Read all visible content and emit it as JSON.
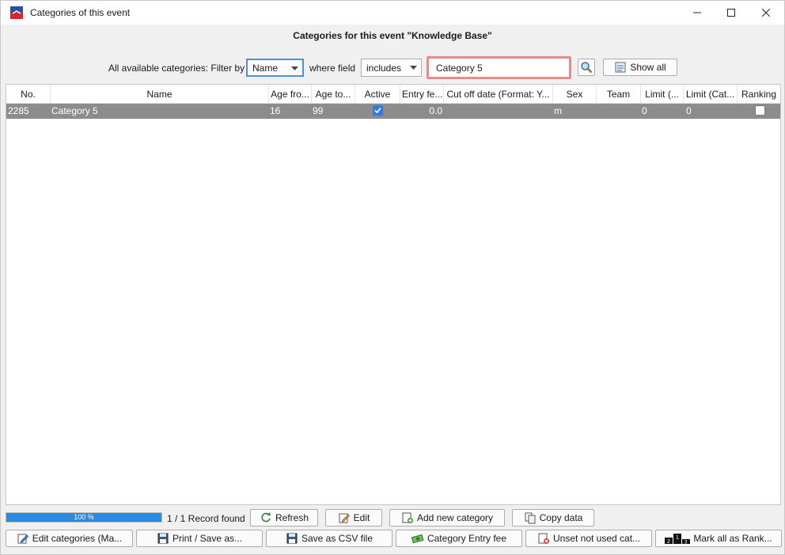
{
  "window": {
    "title": "Categories of this event"
  },
  "heading": "Categories for this event \"Knowledge Base\"",
  "filter": {
    "label": "All available categories: Filter by",
    "field_value": "Name",
    "where_label": "where field",
    "operator_value": "includes",
    "search_value": "Category 5",
    "show_all_label": "Show all"
  },
  "table": {
    "columns": [
      "No.",
      "Name",
      "Age fro...",
      "Age to...",
      "Active",
      "Entry fe...",
      "Cut off date (Format: Y...",
      "Sex",
      "Team",
      "Limit (...",
      "Limit (Cat...",
      "Ranking"
    ],
    "rows": [
      {
        "no": "2285",
        "name": "Category 5",
        "age_from": "16",
        "age_to": "99",
        "active": true,
        "entry_fee": "0.0",
        "cut_off": "",
        "sex": "m",
        "team": "",
        "limit1": "0",
        "limit2": "0",
        "ranking": false
      }
    ]
  },
  "status": {
    "progress_percent": 100,
    "progress_label": "100 %",
    "record_found": "1 / 1 Record found"
  },
  "buttons_row1": {
    "refresh": "Refresh",
    "edit": "Edit",
    "add_new": "Add new category",
    "copy": "Copy data"
  },
  "buttons_row2": {
    "edit_categories": "Edit categories (Ma...",
    "print_save": "Print / Save as...",
    "save_csv": "Save as CSV file",
    "entry_fee": "Category Entry fee",
    "unset": "Unset not used cat...",
    "mark_all": "Mark all as Rank..."
  },
  "colors": {
    "accent": "#2f7de1",
    "selected_row": "#8c8c8c",
    "search_highlight": "#e88a8a"
  }
}
